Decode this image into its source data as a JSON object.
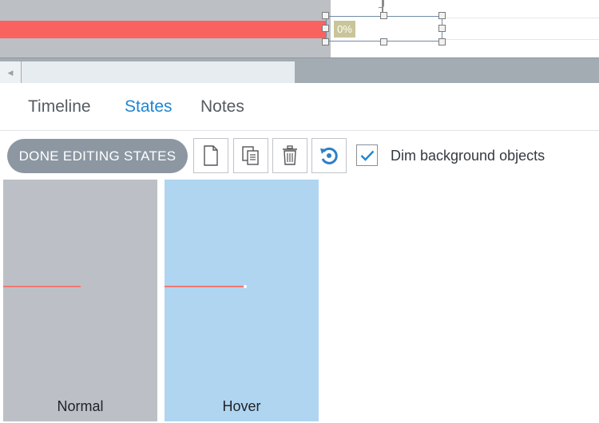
{
  "stage": {
    "progress_label": "0%"
  },
  "tabs": [
    {
      "label": "Timeline",
      "active": false
    },
    {
      "label": "States",
      "active": true
    },
    {
      "label": "Notes",
      "active": false
    }
  ],
  "toolbar": {
    "done_label": "DONE EDITING STATES",
    "buttons": [
      {
        "icon": "new-state-icon"
      },
      {
        "icon": "duplicate-state-icon"
      },
      {
        "icon": "delete-state-icon"
      },
      {
        "icon": "reset-state-icon"
      }
    ],
    "dim_checkbox": {
      "label": "Dim background objects",
      "checked": true
    }
  },
  "states": [
    {
      "name": "Normal",
      "color": "#bcc0c6"
    },
    {
      "name": "Hover",
      "color": "#b0d5f1"
    }
  ],
  "colors": {
    "accent": "#1e86d3",
    "progress_bar": "#fa625f",
    "done_button": "#8c97a2"
  }
}
